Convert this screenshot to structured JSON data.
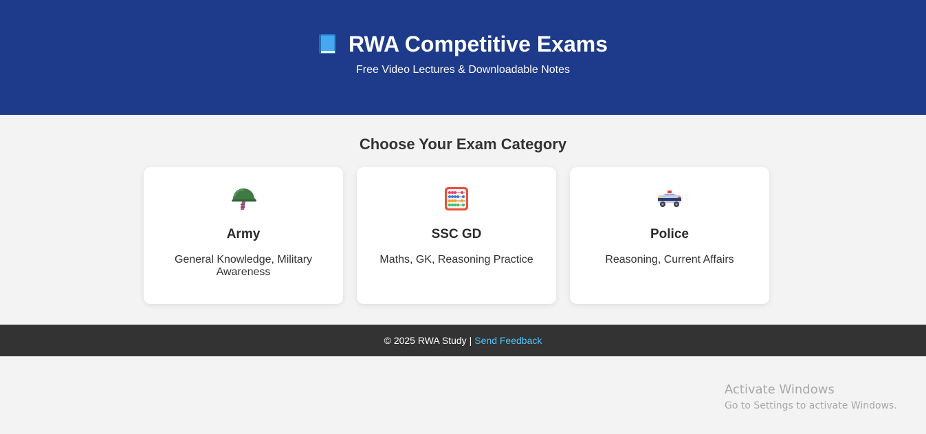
{
  "header": {
    "title": "RWA Competitive Exams",
    "subtitle": "Free Video Lectures & Downloadable Notes",
    "icon": "book-icon",
    "background": "#1e3a8a"
  },
  "section": {
    "title": "Choose Your Exam Category"
  },
  "cards": [
    {
      "icon": "military-helmet-icon",
      "title": "Army",
      "description": "General Knowledge, Military Awareness"
    },
    {
      "icon": "abacus-icon",
      "title": "SSC GD",
      "description": "Maths, GK, Reasoning Practice"
    },
    {
      "icon": "police-car-icon",
      "title": "Police",
      "description": "Reasoning, Current Affairs"
    }
  ],
  "footer": {
    "copyright": "© 2025 RWA Study",
    "separator": "|",
    "link_label": "Send Feedback",
    "link_color": "#4fc3f7",
    "background": "#333333"
  },
  "watermark": {
    "title": "Activate Windows",
    "subtitle": "Go to Settings to activate Windows."
  }
}
